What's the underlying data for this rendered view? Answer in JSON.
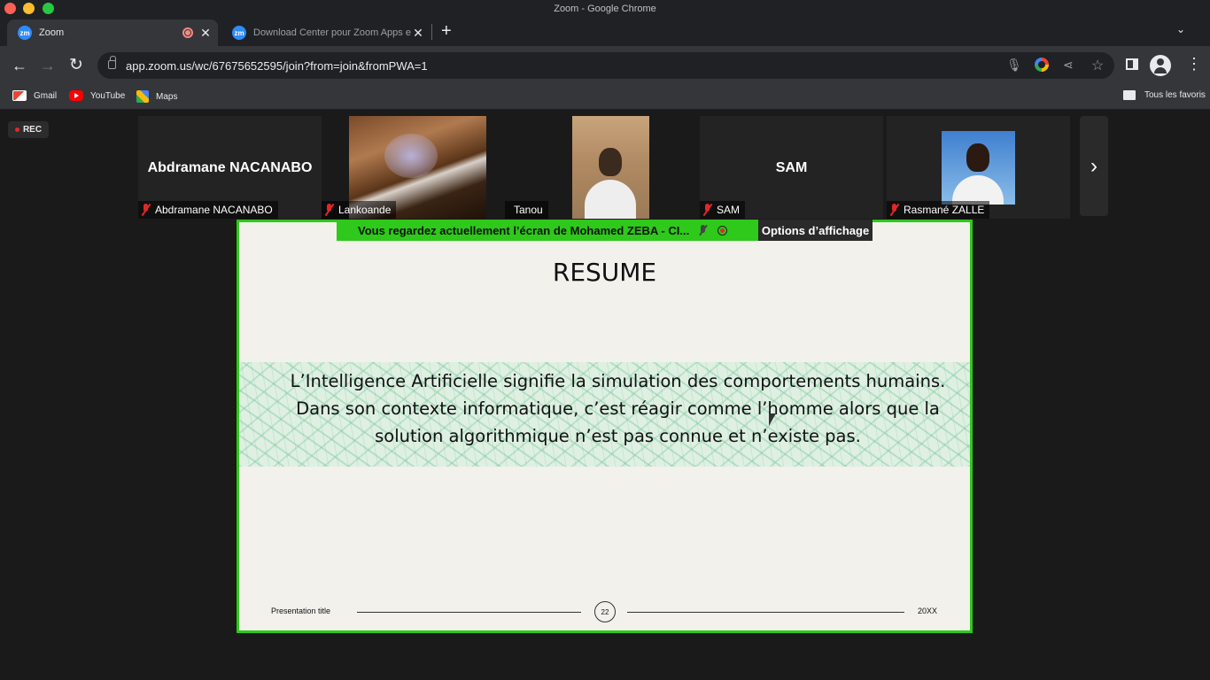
{
  "window": {
    "title": "Zoom - Google Chrome"
  },
  "tabs": [
    {
      "label": "Zoom",
      "favicon": "zm",
      "active": true
    },
    {
      "label": "Download Center pour Zoom Apps et modules",
      "favicon": "zm",
      "active": false
    }
  ],
  "address_bar": {
    "url": "app.zoom.us/wc/67675652595/join?from=join&fromPWA=1"
  },
  "bookmarks": [
    {
      "label": "Gmail",
      "icon": "gmail-icon"
    },
    {
      "label": "YouTube",
      "icon": "youtube-icon"
    },
    {
      "label": "Maps",
      "icon": "maps-icon"
    }
  ],
  "bookmarks_all": "Tous les favoris",
  "zoom": {
    "rec_label": "REC",
    "participants": [
      {
        "display_name": "Abdramane NACANABO",
        "label": "Abdramane NACANABO",
        "muted": true,
        "video": false
      },
      {
        "label": "Lankoande",
        "muted": true,
        "video": true
      },
      {
        "label": "Tanou",
        "muted": false,
        "video": true
      },
      {
        "display_name": "SAM",
        "label": "SAM",
        "muted": true,
        "video": false
      },
      {
        "label": "Rasmané ZALLE",
        "muted": true,
        "video": true
      }
    ],
    "banner": {
      "text": "Vous regardez actuellement l’écran de  Mohamed ZEBA - CI...",
      "options_label": "Options d’affichage"
    },
    "slide": {
      "title": "RESUME",
      "body_lines": [
        "L’Intelligence Artificielle signifie la simulation des comportements humains.",
        "Dans son contexte informatique, c’est réagir comme l’homme alors que la",
        "solution algorithmique n’est pas connue et n’existe pas."
      ],
      "footer_left": "Presentation title",
      "page_number": "22",
      "footer_right": "20XX"
    }
  },
  "colors": {
    "share_border": "#2ec91a",
    "banner_bg": "#2ec91a",
    "rec_dot": "#e02828",
    "muted_mic": "#e02828"
  }
}
